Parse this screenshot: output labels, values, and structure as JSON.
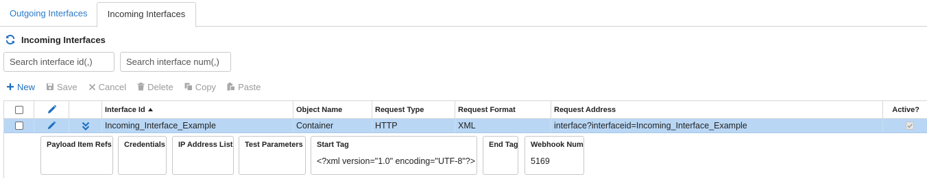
{
  "tabs": [
    {
      "label": "Outgoing Interfaces"
    },
    {
      "label": "Incoming Interfaces"
    }
  ],
  "section": {
    "title": "Incoming Interfaces"
  },
  "search": {
    "id_placeholder": "Search interface id(,)",
    "num_placeholder": "Search interface num(,)"
  },
  "toolbar": {
    "new": "New",
    "save": "Save",
    "cancel": "Cancel",
    "delete": "Delete",
    "copy": "Copy",
    "paste": "Paste"
  },
  "grid": {
    "columns": {
      "interface_id": "Interface Id",
      "object_name": "Object Name",
      "request_type": "Request Type",
      "request_format": "Request Format",
      "request_address": "Request Address",
      "active": "Active?"
    },
    "rows": [
      {
        "interface_id": "Incoming_Interface_Example",
        "object_name": "Container",
        "request_type": "HTTP",
        "request_format": "XML",
        "request_address": "interface?interfaceid=Incoming_Interface_Example",
        "active": true
      }
    ]
  },
  "detail": {
    "payload_item_refs": "Payload Item Refs",
    "credentials": "Credentials",
    "ip_address_list": "IP Address List",
    "test_parameters": "Test Parameters",
    "start_tag_label": "Start Tag",
    "start_tag_value": "<?xml version=\"1.0\" encoding=\"UTF-8\"?>",
    "end_tag_label": "End Tag",
    "webhook_num_label": "Webhook Num",
    "webhook_num_value": "5169"
  },
  "colors": {
    "accent": "#1f6fbf",
    "selected_row": "#b9d7f5",
    "disabled": "#9a9a9a"
  }
}
